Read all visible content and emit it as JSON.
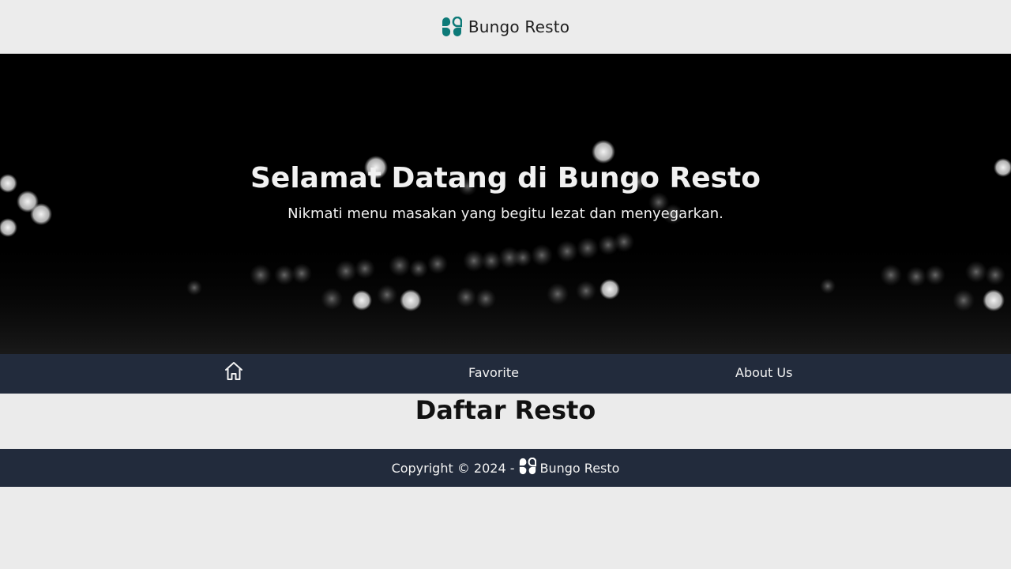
{
  "header": {
    "brand": "Bungo Resto",
    "logo_icon": "clover-logo-icon",
    "logo_color": "#0d7a78"
  },
  "hero": {
    "title": "Selamat Datang di Bungo Resto",
    "subtitle": "Nikmati menu masakan yang begitu lezat dan menyegarkan."
  },
  "nav": {
    "home_icon": "home-icon",
    "favorite_label": "Favorite",
    "about_label": "About Us",
    "background": "#222b3c"
  },
  "main": {
    "section_title": "Daftar Resto"
  },
  "footer": {
    "copyright": "Copyright © 2024 -",
    "brand": "Bungo Resto",
    "background": "#222b3c"
  }
}
